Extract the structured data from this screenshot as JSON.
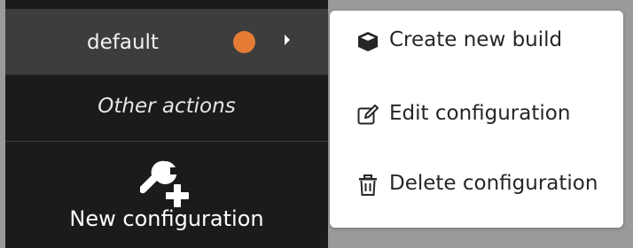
{
  "config_list": {
    "selected": {
      "name": "default",
      "status_color": "#e57c35",
      "expand_icon": "caret-right-icon"
    },
    "other_actions_heading": "Other actions",
    "new_configuration": {
      "icon": "wrench-plus-icon",
      "label": "New configuration"
    }
  },
  "context_menu": {
    "items": [
      {
        "icon": "cube-icon",
        "label": "Create new build"
      },
      {
        "icon": "edit-icon",
        "label": "Edit configuration"
      },
      {
        "icon": "trash-icon",
        "label": "Delete configuration"
      }
    ]
  },
  "colors": {
    "panel_bg": "#1b1b1b",
    "selected_row_bg": "#3d3d3d",
    "menu_bg": "#ffffff",
    "status_dot": "#e57c35"
  }
}
